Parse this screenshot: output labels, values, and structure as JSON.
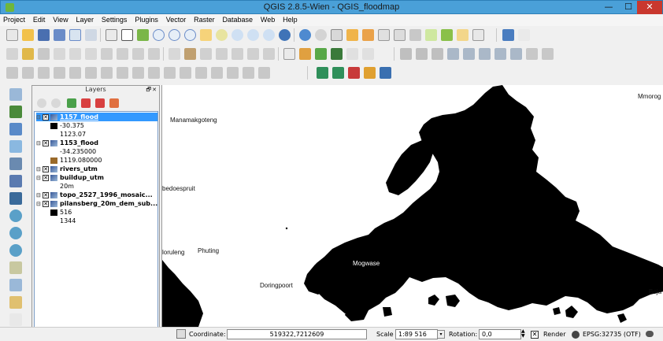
{
  "window": {
    "title": "QGIS 2.8.5-Wien - QGIS_floodmap",
    "minimize": "—",
    "maximize": "☐",
    "close": "✕"
  },
  "menu": [
    "Project",
    "Edit",
    "View",
    "Layer",
    "Settings",
    "Plugins",
    "Vector",
    "Raster",
    "Database",
    "Web",
    "Help"
  ],
  "layers_panel": {
    "title": "Layers",
    "float_label": "🗗✕",
    "items": [
      {
        "label": "1157_flood",
        "kind": "layer",
        "checked": true,
        "selected": true
      },
      {
        "label": "-30.375",
        "kind": "legend",
        "color": "#000000"
      },
      {
        "label": "1123.07",
        "kind": "legend",
        "color": ""
      },
      {
        "label": "1153_flood",
        "kind": "layer",
        "checked": true,
        "selected": false
      },
      {
        "label": "-34.235000",
        "kind": "legend",
        "color": ""
      },
      {
        "label": "1119.080000",
        "kind": "legend",
        "color": "#9a6a2a"
      },
      {
        "label": "rivers_utm",
        "kind": "layer",
        "checked": true,
        "selected": false
      },
      {
        "label": "buildup_utm",
        "kind": "layer",
        "checked": true,
        "selected": false
      },
      {
        "label": "20m",
        "kind": "legend",
        "color": ""
      },
      {
        "label": "topo_2527_1996_mosaic...",
        "kind": "layer",
        "checked": true,
        "selected": false
      },
      {
        "label": "pilansberg_20m_dem_sub...",
        "kind": "layer",
        "checked": true,
        "selected": false
      },
      {
        "label": "516",
        "kind": "legend",
        "color": "#000000"
      },
      {
        "label": "1344",
        "kind": "legend",
        "color": ""
      }
    ]
  },
  "map": {
    "labels": {
      "manamakgoteng": "Manamakgoteng",
      "mmorog": "Mmorog",
      "bedoespruit": "bedoespruit",
      "doruleng": "loruleng",
      "phuting": "Phuting",
      "mogwase": "Mogwase",
      "doringpoort": "Doringpoort",
      "boja": "Boja"
    },
    "flood_color": "#000000"
  },
  "statusbar": {
    "coordinate_label": "Coordinate:",
    "coordinate_value": "519322,7212609",
    "scale_label": "Scale",
    "scale_value": "1:89 516",
    "rotation_label": "Rotation:",
    "rotation_value": "0,0",
    "render_label": "Render",
    "crs_label": "EPSG:32735 (OTF)"
  }
}
